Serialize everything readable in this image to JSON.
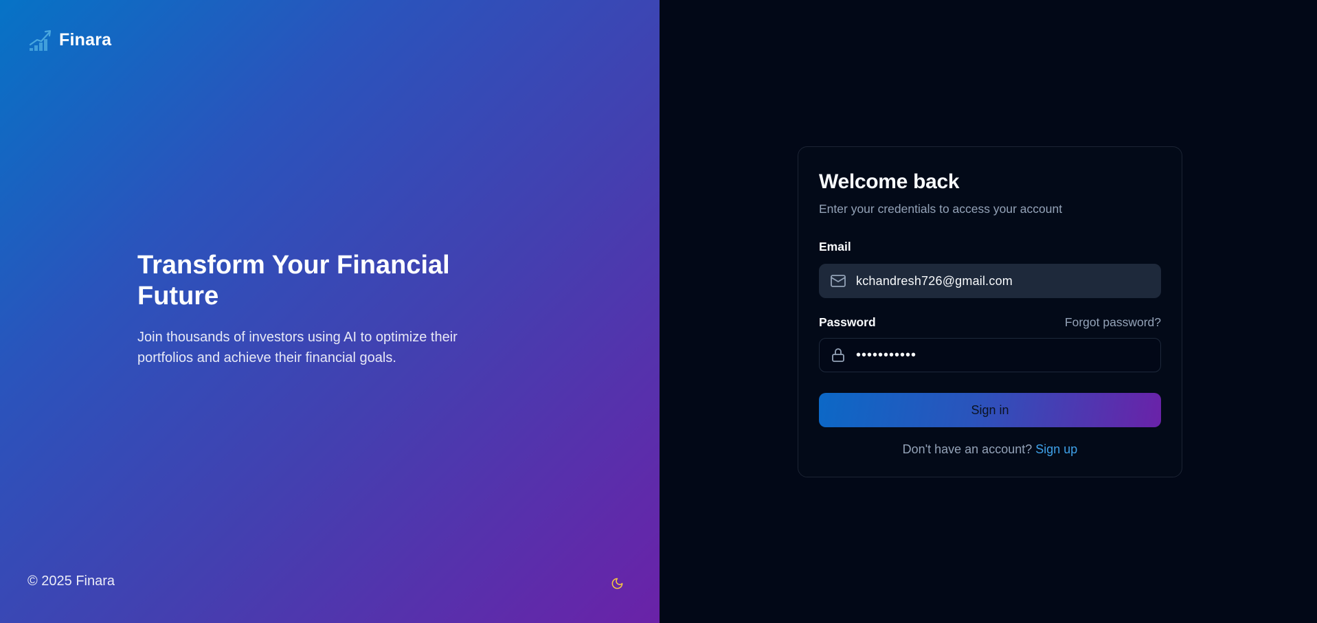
{
  "brand": {
    "name": "Finara",
    "icon": "chart-trend-up-icon",
    "icon_color": "#4aa8df"
  },
  "hero": {
    "title": "Transform Your Financial Future",
    "subtitle": "Join thousands of investors using AI to optimize their portfolios and achieve their financial goals.",
    "gradient": [
      "#0673c6",
      "#4340b0",
      "#6a22a8"
    ]
  },
  "footer": {
    "copyright": "© 2025 Finara",
    "theme_toggle_icon": "moon-icon",
    "theme_toggle_color": "#f5c842"
  },
  "login": {
    "title": "Welcome back",
    "subtitle": "Enter your credentials to access your account",
    "email": {
      "label": "Email",
      "value": "kchandresh726@gmail.com",
      "icon": "mail-icon"
    },
    "password": {
      "label": "Password",
      "value": "•••••••••••",
      "icon": "lock-icon",
      "forgot_label": "Forgot password?"
    },
    "submit_label": "Sign in",
    "signup_prompt": "Don't have an account?",
    "signup_link": "Sign up"
  },
  "colors": {
    "background": "#020817",
    "card_border": "#1c2434",
    "input_fill": "#1e293b",
    "muted_text": "#94a3b8",
    "link": "#3fa2ea"
  }
}
